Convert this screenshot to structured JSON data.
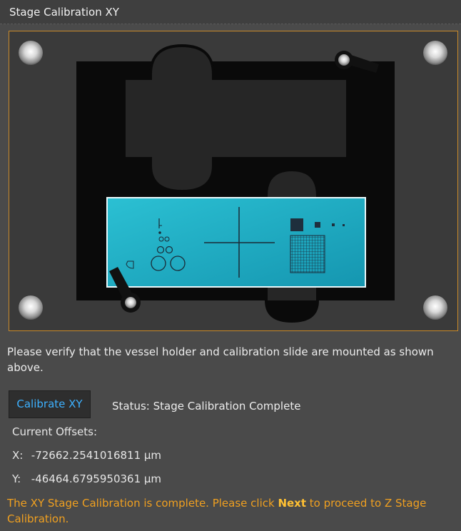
{
  "window": {
    "title": "Stage Calibration XY"
  },
  "diagram": {
    "colors": {
      "frame_border": "#c98a2a",
      "holder": "#0a0a0a",
      "slide": "#20b2c8",
      "screw": "#cfcfcf",
      "clip": "#111111"
    },
    "icons": [
      "screw-icon",
      "clip-icon"
    ]
  },
  "instructions": "Please verify that the vessel holder and calibration slide are mounted as shown above.",
  "calibrate_button": {
    "label": "Calibrate XY"
  },
  "status": {
    "label": "Status:",
    "value": "Stage Calibration Complete"
  },
  "offsets": {
    "label": "Current Offsets:",
    "x_axis": "X:",
    "x_value": "-72662.2541016811 µm",
    "y_axis": "Y:",
    "y_value": "-46464.6795950361 µm"
  },
  "completion": {
    "before": "The XY Stage Calibration is complete. Please click ",
    "emphasis": "Next",
    "after": " to proceed to Z Stage Calibration."
  },
  "accent_colors": {
    "button_text": "#3db1ff",
    "message_text": "#f0a020"
  }
}
